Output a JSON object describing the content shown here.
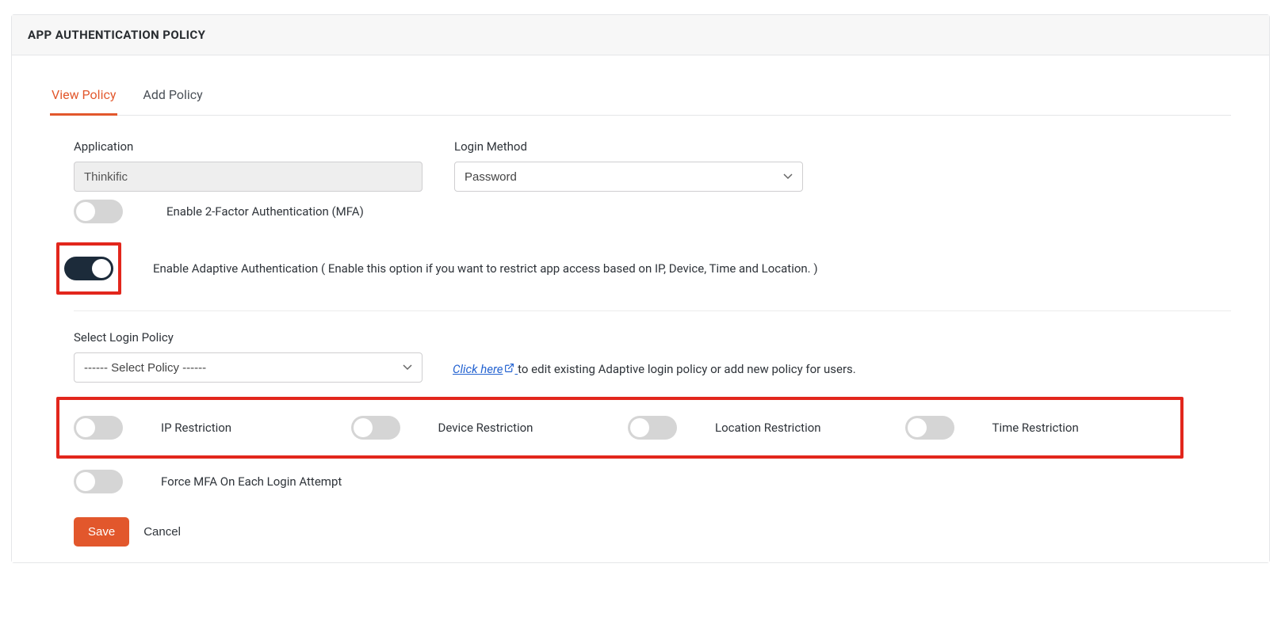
{
  "panel": {
    "title": "APP AUTHENTICATION POLICY"
  },
  "tabs": {
    "view": "View Policy",
    "add": "Add Policy"
  },
  "form": {
    "application_label": "Application",
    "application_value": "Thinkific",
    "login_method_label": "Login Method",
    "login_method_value": "Password",
    "mfa_label": "Enable 2-Factor Authentication (MFA)",
    "adaptive_label": "Enable Adaptive Authentication ( Enable this option if you want to restrict app access based on IP, Device, Time and Location. )",
    "select_policy_label": "Select Login Policy",
    "select_policy_value": "------ Select Policy ------",
    "click_here": "Click here",
    "click_here_suffix": " to edit existing Adaptive login policy or add new policy for users.",
    "restrictions": {
      "ip": "IP Restriction",
      "device": "Device Restriction",
      "location": "Location Restriction",
      "time": "Time Restriction"
    },
    "force_mfa_label": "Force MFA On Each Login Attempt"
  },
  "actions": {
    "save": "Save",
    "cancel": "Cancel"
  },
  "colors": {
    "accent": "#e2572c",
    "highlight": "#e2261c",
    "toggle_on": "#1c2b3a",
    "link": "#2463d1"
  }
}
